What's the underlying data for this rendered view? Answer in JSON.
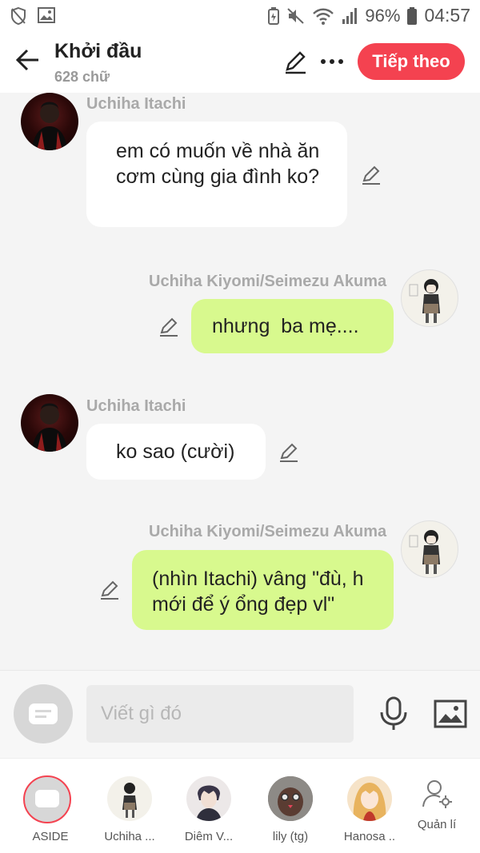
{
  "status_bar": {
    "battery": "96%",
    "time": "04:57"
  },
  "header": {
    "title": "Khởi đầu",
    "subtitle": "628 chữ",
    "next_label": "Tiếp theo"
  },
  "messages": [
    {
      "side": "left",
      "sender": "Uchiha Itachi",
      "text": " em có muốn về nhà ăn cơm cùng gia đình ko?"
    },
    {
      "side": "right",
      "sender": "Uchiha Kiyomi/Seimezu Akuma",
      "text": "nhưng  ba mẹ...."
    },
    {
      "side": "left",
      "sender": "Uchiha Itachi",
      "text": "ko sao (cười)"
    },
    {
      "side": "right",
      "sender": "Uchiha Kiyomi/Seimezu Akuma",
      "text": "(nhìn Itachi) vâng \"đù, h mới để ý ổng đẹp vl\""
    }
  ],
  "input": {
    "placeholder": "Viết gì đó"
  },
  "characters": [
    {
      "label": "ASIDE"
    },
    {
      "label": "Uchiha ..."
    },
    {
      "label": "Diêm V..."
    },
    {
      "label": "lily (tg)"
    },
    {
      "label": "Hanosa .."
    }
  ],
  "manage_label": "Quản lí",
  "colors": {
    "accent": "#f44250",
    "bubble_right": "#d8f98e",
    "bubble_left": "#ffffff",
    "background": "#f4f4f4"
  },
  "icons": [
    "back-arrow-icon",
    "pencil-icon",
    "more-dots-icon",
    "mic-icon",
    "image-icon",
    "manage-user-icon",
    "aside-chat-icon"
  ]
}
